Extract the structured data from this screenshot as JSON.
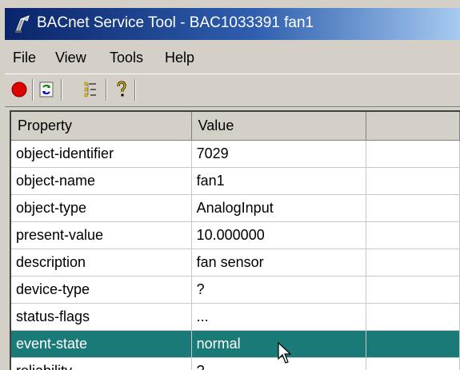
{
  "window": {
    "title": "BACnet Service Tool - BAC1033391 fan1"
  },
  "menu": [
    "File",
    "View",
    "Tools",
    "Help"
  ],
  "toolbar": {
    "buttons": [
      "stop-icon",
      "refresh-icon",
      "tree-view-icon",
      "help-icon"
    ]
  },
  "grid": {
    "columns": [
      "Property",
      "Value",
      ""
    ],
    "rows": [
      {
        "property": "object-identifier",
        "value": "7029"
      },
      {
        "property": "object-name",
        "value": "fan1"
      },
      {
        "property": "object-type",
        "value": "AnalogInput"
      },
      {
        "property": "present-value",
        "value": "10.000000"
      },
      {
        "property": "description",
        "value": "fan sensor"
      },
      {
        "property": "device-type",
        "value": "?"
      },
      {
        "property": "status-flags",
        "value": "..."
      },
      {
        "property": "event-state",
        "value": "normal",
        "selected": true
      },
      {
        "property": "reliability",
        "value": "?"
      }
    ]
  },
  "colors": {
    "selection": "#1a7a78",
    "title_gradient_start": "#0a246a",
    "title_gradient_end": "#a6caf0"
  }
}
